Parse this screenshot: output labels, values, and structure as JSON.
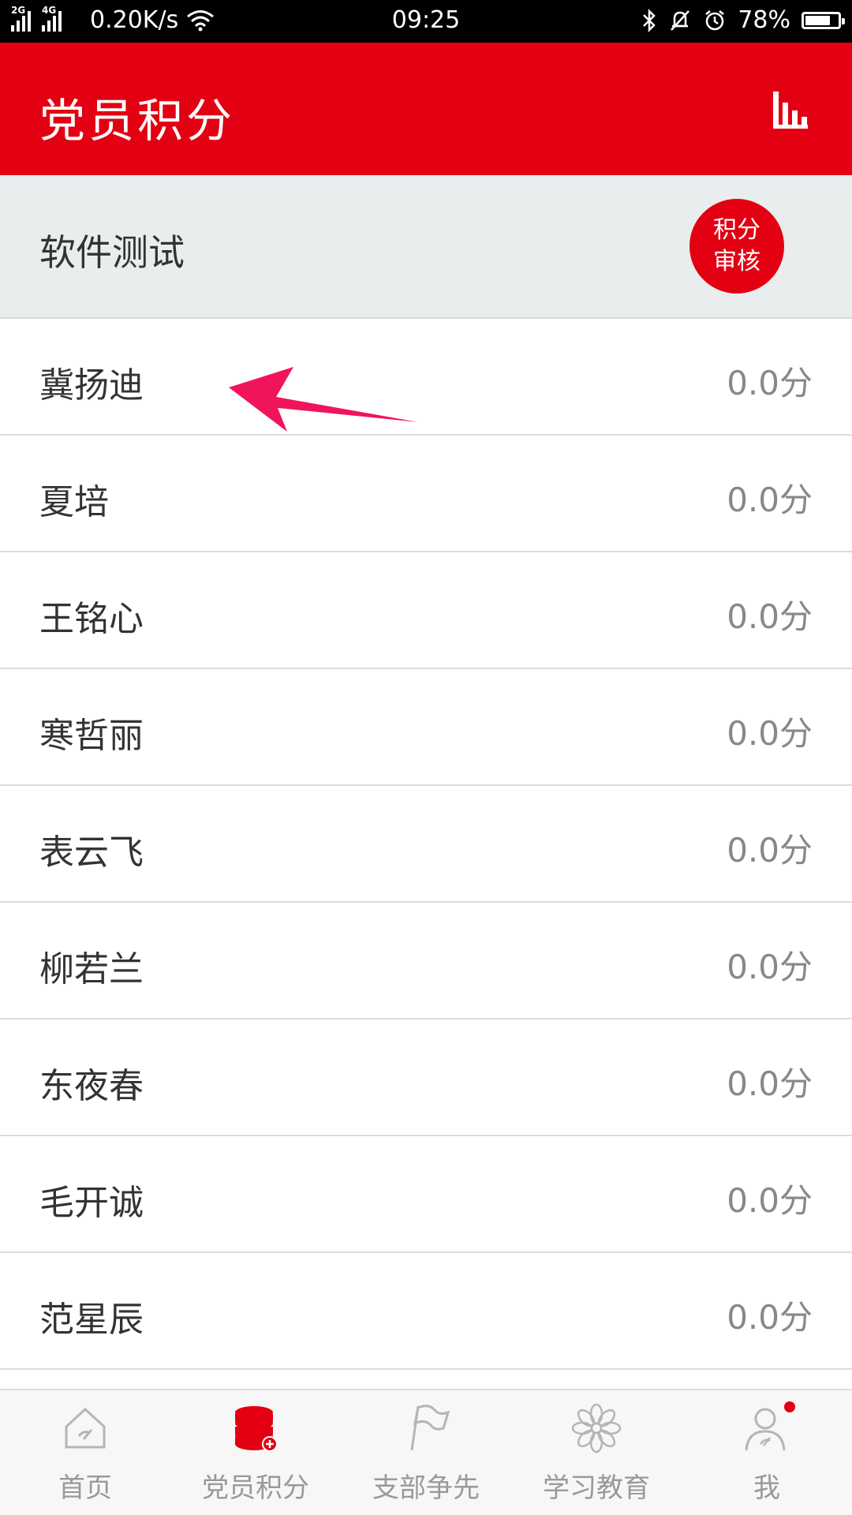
{
  "status_bar": {
    "net_left": "2G",
    "net_right": "4G",
    "speed": "0.20K/s",
    "time": "09:25",
    "battery": "78%",
    "battery_level": 0.78
  },
  "header": {
    "title": "党员积分",
    "stats_icon": "bar-chart-icon"
  },
  "branch": {
    "name": "软件测试",
    "review_line1": "积分",
    "review_line2": "审核"
  },
  "members": [
    {
      "name": "冀扬迪",
      "score": "0.0分"
    },
    {
      "name": "夏培",
      "score": "0.0分"
    },
    {
      "name": "王铭心",
      "score": "0.0分"
    },
    {
      "name": "寒哲丽",
      "score": "0.0分"
    },
    {
      "name": "表云飞",
      "score": "0.0分"
    },
    {
      "name": "柳若兰",
      "score": "0.0分"
    },
    {
      "name": "东夜春",
      "score": "0.0分"
    },
    {
      "name": "毛开诚",
      "score": "0.0分"
    },
    {
      "name": "范星辰",
      "score": "0.0分"
    }
  ],
  "nav": [
    {
      "label": "首页",
      "icon": "home-icon"
    },
    {
      "label": "党员积分",
      "icon": "points-database-icon"
    },
    {
      "label": "支部争先",
      "icon": "flag-icon"
    },
    {
      "label": "学习教育",
      "icon": "flower-icon"
    },
    {
      "label": "我",
      "icon": "profile-icon"
    }
  ],
  "colors": {
    "accent": "#e30012",
    "inactive": "#999999"
  }
}
